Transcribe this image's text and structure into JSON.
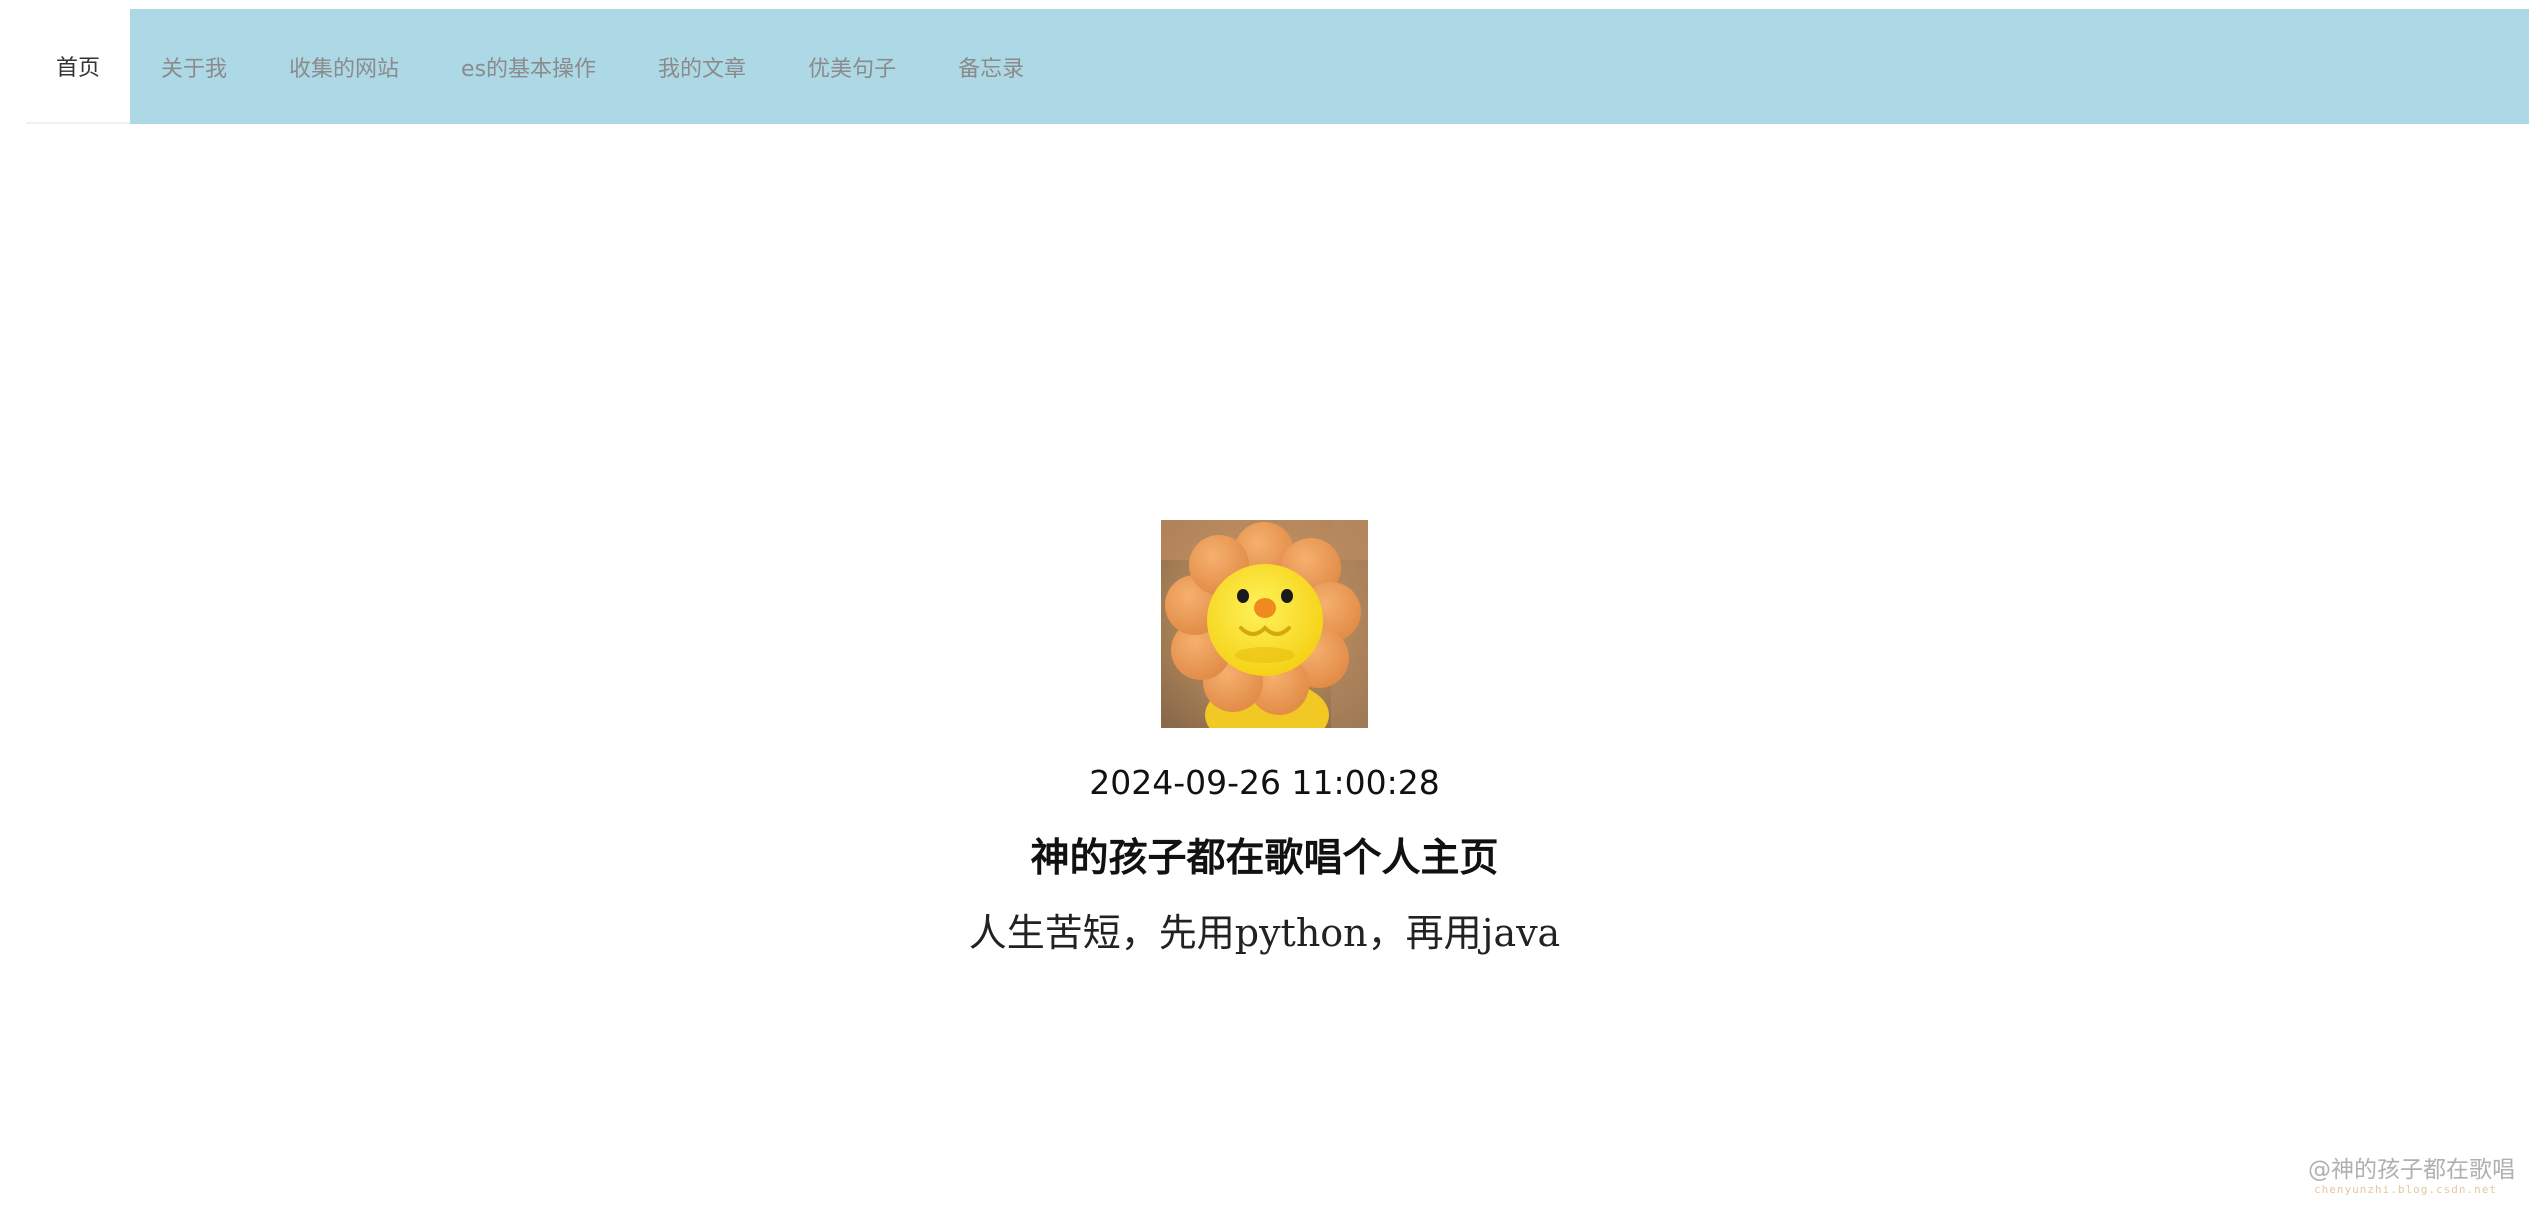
{
  "nav": {
    "items": [
      {
        "label": "首页",
        "active": true
      },
      {
        "label": "关于我"
      },
      {
        "label": "收集的网站"
      },
      {
        "label": "es的基本操作"
      },
      {
        "label": "我的文章"
      },
      {
        "label": "优美句子"
      },
      {
        "label": "备忘录"
      }
    ],
    "bar_color": "#add8e6"
  },
  "profile": {
    "avatar_icon": "yellow-flower-plush-toy-avatar",
    "datetime": "2024-09-26 11:00:28",
    "title": "神的孩子都在歌唱个人主页",
    "motto": "人生苦短，先用python，再用java"
  },
  "watermark": {
    "text": "@神的孩子都在歌唱",
    "sub": "chenyunzhi.blog.csdn.net"
  }
}
